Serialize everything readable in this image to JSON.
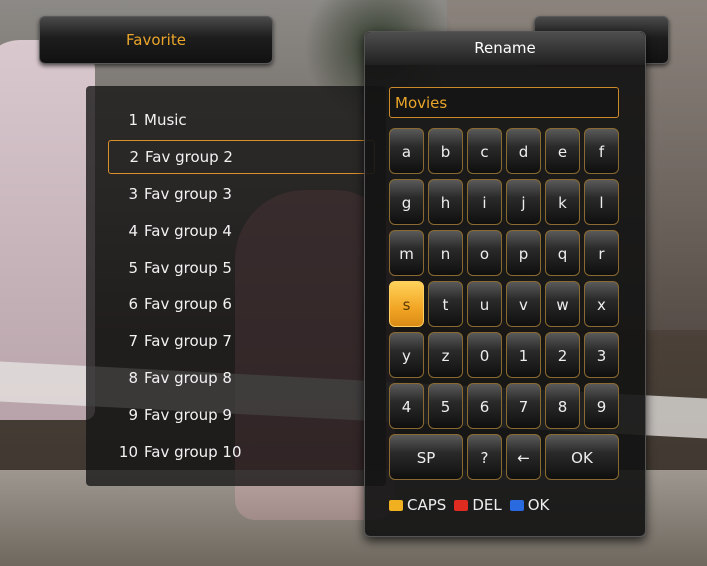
{
  "header": {
    "favorite_label": "Favorite"
  },
  "list": {
    "items": [
      {
        "num": "1",
        "label": "Music"
      },
      {
        "num": "2",
        "label": "Fav group 2"
      },
      {
        "num": "3",
        "label": "Fav group 3"
      },
      {
        "num": "4",
        "label": "Fav group 4"
      },
      {
        "num": "5",
        "label": "Fav group 5"
      },
      {
        "num": "6",
        "label": "Fav group 6"
      },
      {
        "num": "7",
        "label": "Fav group 7"
      },
      {
        "num": "8",
        "label": "Fav group 8"
      },
      {
        "num": "9",
        "label": "Fav group 9"
      },
      {
        "num": "10",
        "label": "Fav group 10"
      }
    ],
    "selected_index": 1
  },
  "dialog": {
    "title": "Rename",
    "input_value": "Movies",
    "keys": {
      "row1": [
        "a",
        "b",
        "c",
        "d",
        "e",
        "f"
      ],
      "row2": [
        "g",
        "h",
        "i",
        "j",
        "k",
        "l"
      ],
      "row3": [
        "m",
        "n",
        "o",
        "p",
        "q",
        "r"
      ],
      "row4": [
        "s",
        "t",
        "u",
        "v",
        "w",
        "x"
      ],
      "row5": [
        "y",
        "z",
        "0",
        "1",
        "2",
        "3"
      ],
      "row6": [
        "4",
        "5",
        "6",
        "7",
        "8",
        "9"
      ],
      "row7": [
        "SP",
        "?",
        "←",
        "OK"
      ]
    },
    "active_key": "s",
    "legend": [
      {
        "color": "#f0b020",
        "label": "CAPS"
      },
      {
        "color": "#e02b20",
        "label": "DEL"
      },
      {
        "color": "#2a6ae0",
        "label": "OK"
      }
    ]
  },
  "colors": {
    "accent": "#e9a52a",
    "selection_border": "#d8902a"
  }
}
